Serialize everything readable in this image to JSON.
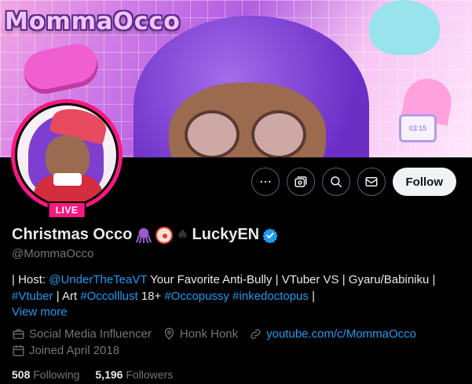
{
  "banner": {
    "logo_text": "MommaOcco",
    "clock_text": "03:15"
  },
  "avatar": {
    "live_label": "LIVE"
  },
  "actions": {
    "more_icon": "more-icon",
    "subscribe_icon": "subscribe-icon",
    "search_icon": "search-icon",
    "message_icon": "message-icon",
    "follow_label": "Follow"
  },
  "profile": {
    "display_name_prefix": "Christmas Occo",
    "emoji_1": "octopus",
    "emoji_2": "clown",
    "emoji_3": "♠",
    "display_name_suffix": " LuckyEN",
    "verified": true,
    "handle": "@MommaOcco"
  },
  "bio": {
    "line1_prefix": "| Host: ",
    "mention": "@UnderTheTeaVT",
    "line1_suffix": " Your Favorite Anti-Bully | VTuber VS | Gyaru/Babiniku |",
    "tag1": "#Vtuber",
    "sep1": " | Art ",
    "tag2": "#Occolllust",
    "sep2": " 18+ ",
    "tag3": "#Occopussy",
    "sep3": " ",
    "tag4": "#inkedoctopus",
    "end": " |",
    "view_more": "View more"
  },
  "meta": {
    "category": "Social Media Influencer",
    "location": "Honk Honk",
    "website": "youtube.com/c/MommaOcco",
    "joined": "Joined April 2018"
  },
  "stats": {
    "following_count": "508",
    "following_label": "Following",
    "followers_count": "5,196",
    "followers_label": "Followers"
  },
  "colors": {
    "accent_blue": "#1d9bf0",
    "live_pink": "#f91880",
    "background": "#000000"
  }
}
